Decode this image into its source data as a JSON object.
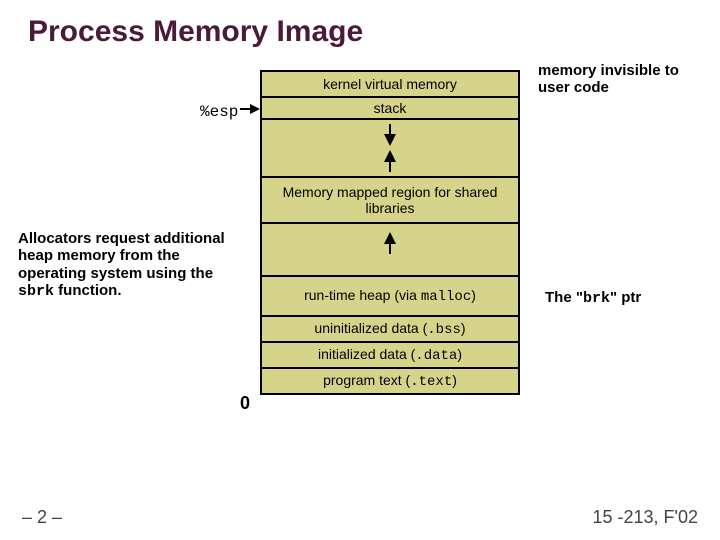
{
  "title": "Process Memory Image",
  "blocks": {
    "kernel": "kernel virtual memory",
    "stack": "stack",
    "mmap": "Memory mapped region for shared libraries",
    "heap_pre": "run-time heap (via ",
    "heap_mono": "malloc",
    "heap_post": ")",
    "bss_pre": "uninitialized data (",
    "bss_mono": ".bss",
    "bss_post": ")",
    "data_pre": "initialized data (",
    "data_mono": ".data",
    "data_post": ")",
    "text_pre": "program text (",
    "text_mono": ".text",
    "text_post": ")"
  },
  "labels": {
    "esp": "%esp",
    "mem_invisible": "memory invisible to user code",
    "alloc_pre": "Allocators request additional heap memory from the operating system using the ",
    "alloc_mono": "sbrk",
    "alloc_post": " function.",
    "brk_pre": "The \"",
    "brk_mono": "brk",
    "brk_post": "\" ptr",
    "zero": "0"
  },
  "footer": {
    "left": "– 2 –",
    "right": "15 -213, F'02"
  }
}
